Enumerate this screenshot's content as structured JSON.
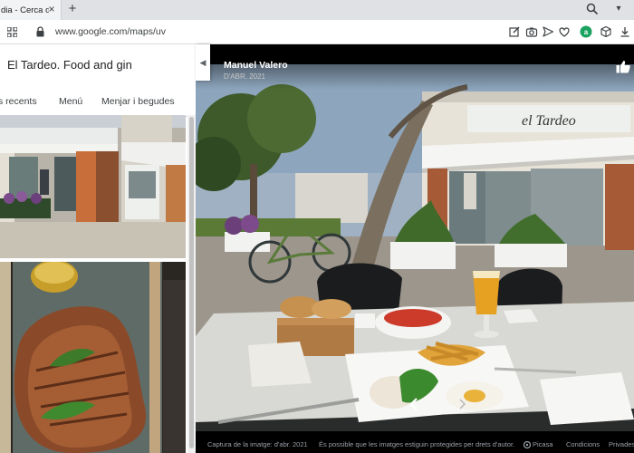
{
  "browser": {
    "tab_title": "dia - Cerca de",
    "url": "www.google.com/maps/uv"
  },
  "place": {
    "title": "El Tardeo. Food and gin",
    "tabs": [
      "s recents",
      "Menú",
      "Menjar i begudes"
    ]
  },
  "viewer": {
    "author": "Manuel Valero",
    "date": "D'ABR. 2021",
    "footer": {
      "capture": "Captura de la imatge: d'abr. 2021",
      "copyright": "És possible que les imatges estiguin protegides per drets d'autor.",
      "picasa": "Picasa",
      "conditions": "Condicions",
      "privacy": "Privadesa"
    }
  },
  "colors": {
    "accent_green": "#1aa260",
    "sign_bg": "#eef0ee"
  }
}
